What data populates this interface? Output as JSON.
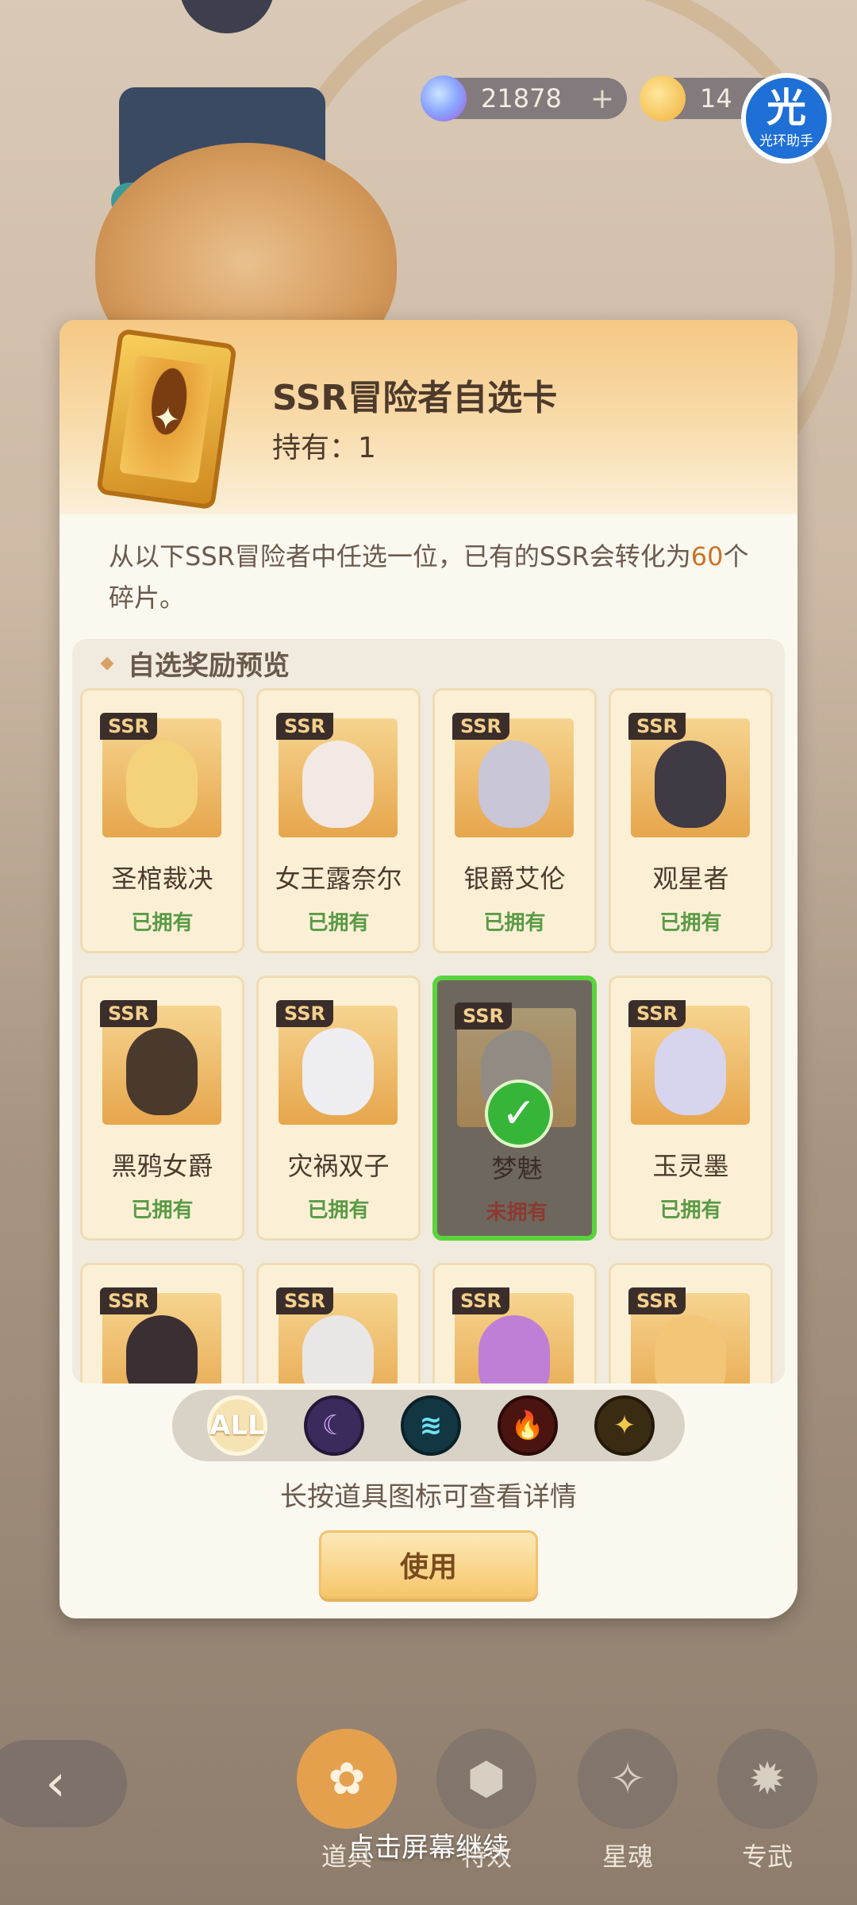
{
  "resources": {
    "gems": "21878",
    "gold": "14",
    "plus": "+"
  },
  "helper": {
    "glyph": "光",
    "label": "光环助手"
  },
  "dialog": {
    "item_title": "SSR冒险者自选卡",
    "owned_label": "持有：",
    "owned_count": "1",
    "description_part1": "从以下SSR冒险者中任选一位，已有的SSR会转化为",
    "description_number": "60",
    "description_part2": "个碎片。",
    "section_title": "自选奖励预览",
    "ssr_tag": "SSR",
    "heroes": [
      {
        "name": "圣棺裁决",
        "status": "已拥有"
      },
      {
        "name": "女王露奈尔",
        "status": "已拥有"
      },
      {
        "name": "银爵艾伦",
        "status": "已拥有"
      },
      {
        "name": "观星者",
        "status": "已拥有"
      },
      {
        "name": "黑鸦女爵",
        "status": "已拥有"
      },
      {
        "name": "灾祸双子",
        "status": "已拥有"
      },
      {
        "name": "梦魅",
        "status": "未拥有",
        "selected": true
      },
      {
        "name": "玉灵墨",
        "status": "已拥有"
      },
      {
        "name": "",
        "status": ""
      },
      {
        "name": "",
        "status": ""
      },
      {
        "name": "",
        "status": ""
      },
      {
        "name": "",
        "status": ""
      }
    ],
    "filters": [
      {
        "label": "ALL",
        "icon": "all-icon"
      },
      {
        "label": "☾",
        "icon": "moon-element-icon"
      },
      {
        "label": "≋",
        "icon": "wind-element-icon"
      },
      {
        "label": "🔥",
        "icon": "fire-element-icon"
      },
      {
        "label": "✦",
        "icon": "star-element-icon"
      }
    ],
    "long_press_hint": "长按道具图标可查看详情",
    "use_label": "使用"
  },
  "bottom_nav": {
    "back": "‹",
    "items": [
      {
        "label": "道具",
        "icon": "bag-icon",
        "active": true
      },
      {
        "label": "特效",
        "icon": "dice-icon"
      },
      {
        "label": "星魂",
        "icon": "card-icon"
      },
      {
        "label": "专武",
        "icon": "gear-icon"
      }
    ]
  },
  "continue_hint": "点击屏幕继续",
  "colors": {
    "accent_orange": "#c8742a",
    "owned_green": "#5a9a45",
    "selected_border": "#5ad33c",
    "not_owned_red": "#8c3a30"
  }
}
